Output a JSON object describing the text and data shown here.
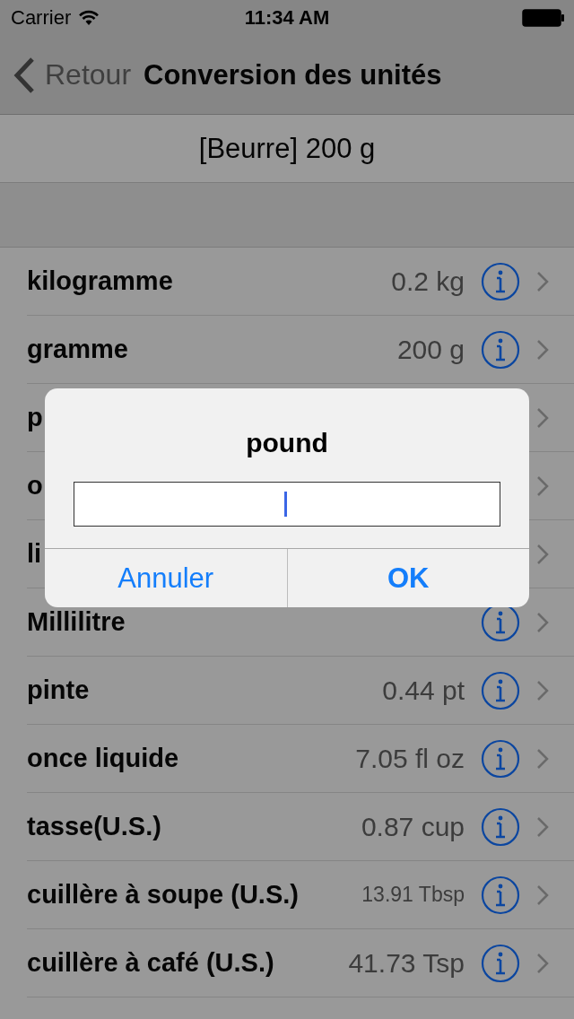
{
  "status_bar": {
    "carrier": "Carrier",
    "time": "11:34 AM"
  },
  "nav_bar": {
    "back": "Retour",
    "title": "Conversion des unités"
  },
  "header": "[Beurre] 200 g",
  "rows": [
    {
      "name": "kilogramme",
      "value": "0.2 kg",
      "info": true
    },
    {
      "name": "gramme",
      "value": "200 g",
      "info": true
    },
    {
      "name": "p",
      "info": false
    },
    {
      "name": "o",
      "info": false
    },
    {
      "name": "li",
      "info": false
    },
    {
      "name": "Millilitre",
      "info": true
    },
    {
      "name": "pinte",
      "value": "0.44 pt",
      "info": true
    },
    {
      "name": "once liquide",
      "value": "7.05 fl oz",
      "info": true
    },
    {
      "name": "tasse(U.S.)",
      "value": "0.87 cup",
      "info": true
    },
    {
      "name": "cuillère à soupe (U.S.)",
      "value": "13.91 Tbsp",
      "small": true,
      "info": true
    },
    {
      "name": "cuillère à café (U.S.)",
      "value": "41.73 Tsp",
      "info": true
    }
  ],
  "alert": {
    "title": "pound",
    "buttons": [
      {
        "label": "Annuler",
        "kind": "cancel"
      },
      {
        "label": "OK",
        "kind": "default"
      }
    ]
  }
}
